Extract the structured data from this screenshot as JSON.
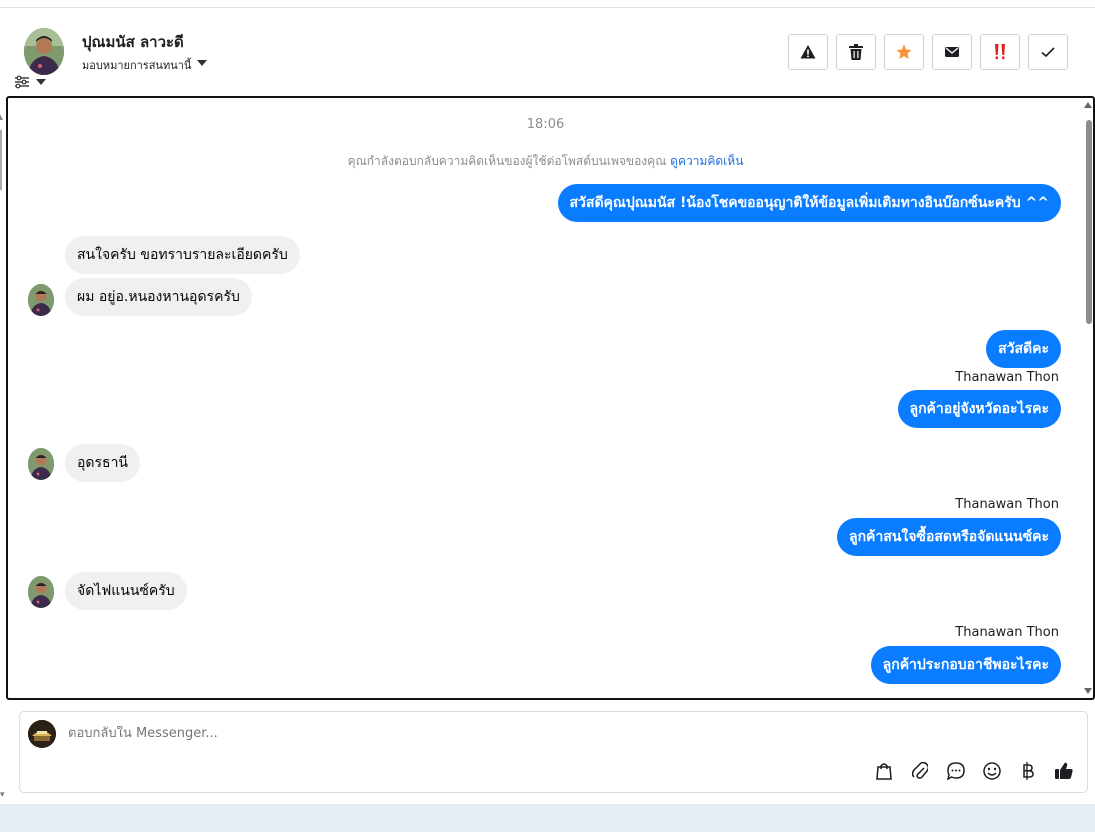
{
  "header": {
    "contact_name": "ปุณมนัส ลาวะดี",
    "assign_label": "มอบหมายการสนทนานี้",
    "actions": [
      {
        "name": "report-spam-button",
        "icon": "warning-icon"
      },
      {
        "name": "delete-button",
        "icon": "trash-icon"
      },
      {
        "name": "star-button",
        "icon": "star-icon"
      },
      {
        "name": "mark-unread-button",
        "icon": "envelope-icon"
      },
      {
        "name": "important-button",
        "icon": "double-exclamation-icon"
      },
      {
        "name": "mark-done-button",
        "icon": "check-icon"
      }
    ],
    "colors": {
      "star": "#f7923b",
      "important": "#e02020"
    }
  },
  "chat": {
    "timestamp": "18:06",
    "notice_text": "คุณกำลังตอบกลับความคิดเห็นของผู้ใช้ต่อโพสต์บนเพจของคุณ",
    "notice_link": "ดูความคิดเห็น",
    "messages": [
      {
        "dir": "out",
        "text": "สวัสดีคุณปุณมนัส !น้องโชคขออนุญาติให้ข้อมูลเพิ่มเติมทางอินบ๊อกซ์นะครับ ^^"
      },
      {
        "dir": "in",
        "text": "สนใจครับ ขอทราบรายละเอียดครับ"
      },
      {
        "dir": "in",
        "text": "ผม อยู่อ.หนองหานอุดรครับ"
      },
      {
        "dir": "out",
        "text": "สวัสดีคะ"
      },
      {
        "dir": "out",
        "sender": "Thanawan Thon",
        "text": "ลูกค้าอยู่จังหวัดอะไรคะ"
      },
      {
        "dir": "in",
        "text": "อุดรธานี"
      },
      {
        "dir": "out",
        "sender": "Thanawan Thon",
        "text": "ลูกค้าสนใจซื้อสดหรือจัดแนนซ์คะ"
      },
      {
        "dir": "in",
        "text": "จัดไฟแนนซ์ครับ"
      },
      {
        "dir": "out",
        "sender": "Thanawan Thon",
        "text": "ลูกค้าประกอบอาชีพอะไรคะ"
      }
    ],
    "colors": {
      "outgoing": "#0a7cff",
      "incoming": "#f0f0f0",
      "link": "#216fdb"
    }
  },
  "composer": {
    "placeholder": "ตอบกลับใน Messenger...",
    "icons": [
      "shopping-bag-icon",
      "paperclip-icon",
      "saved-reply-icon",
      "emoji-icon",
      "baht-icon",
      "thumbs-up-icon"
    ]
  }
}
